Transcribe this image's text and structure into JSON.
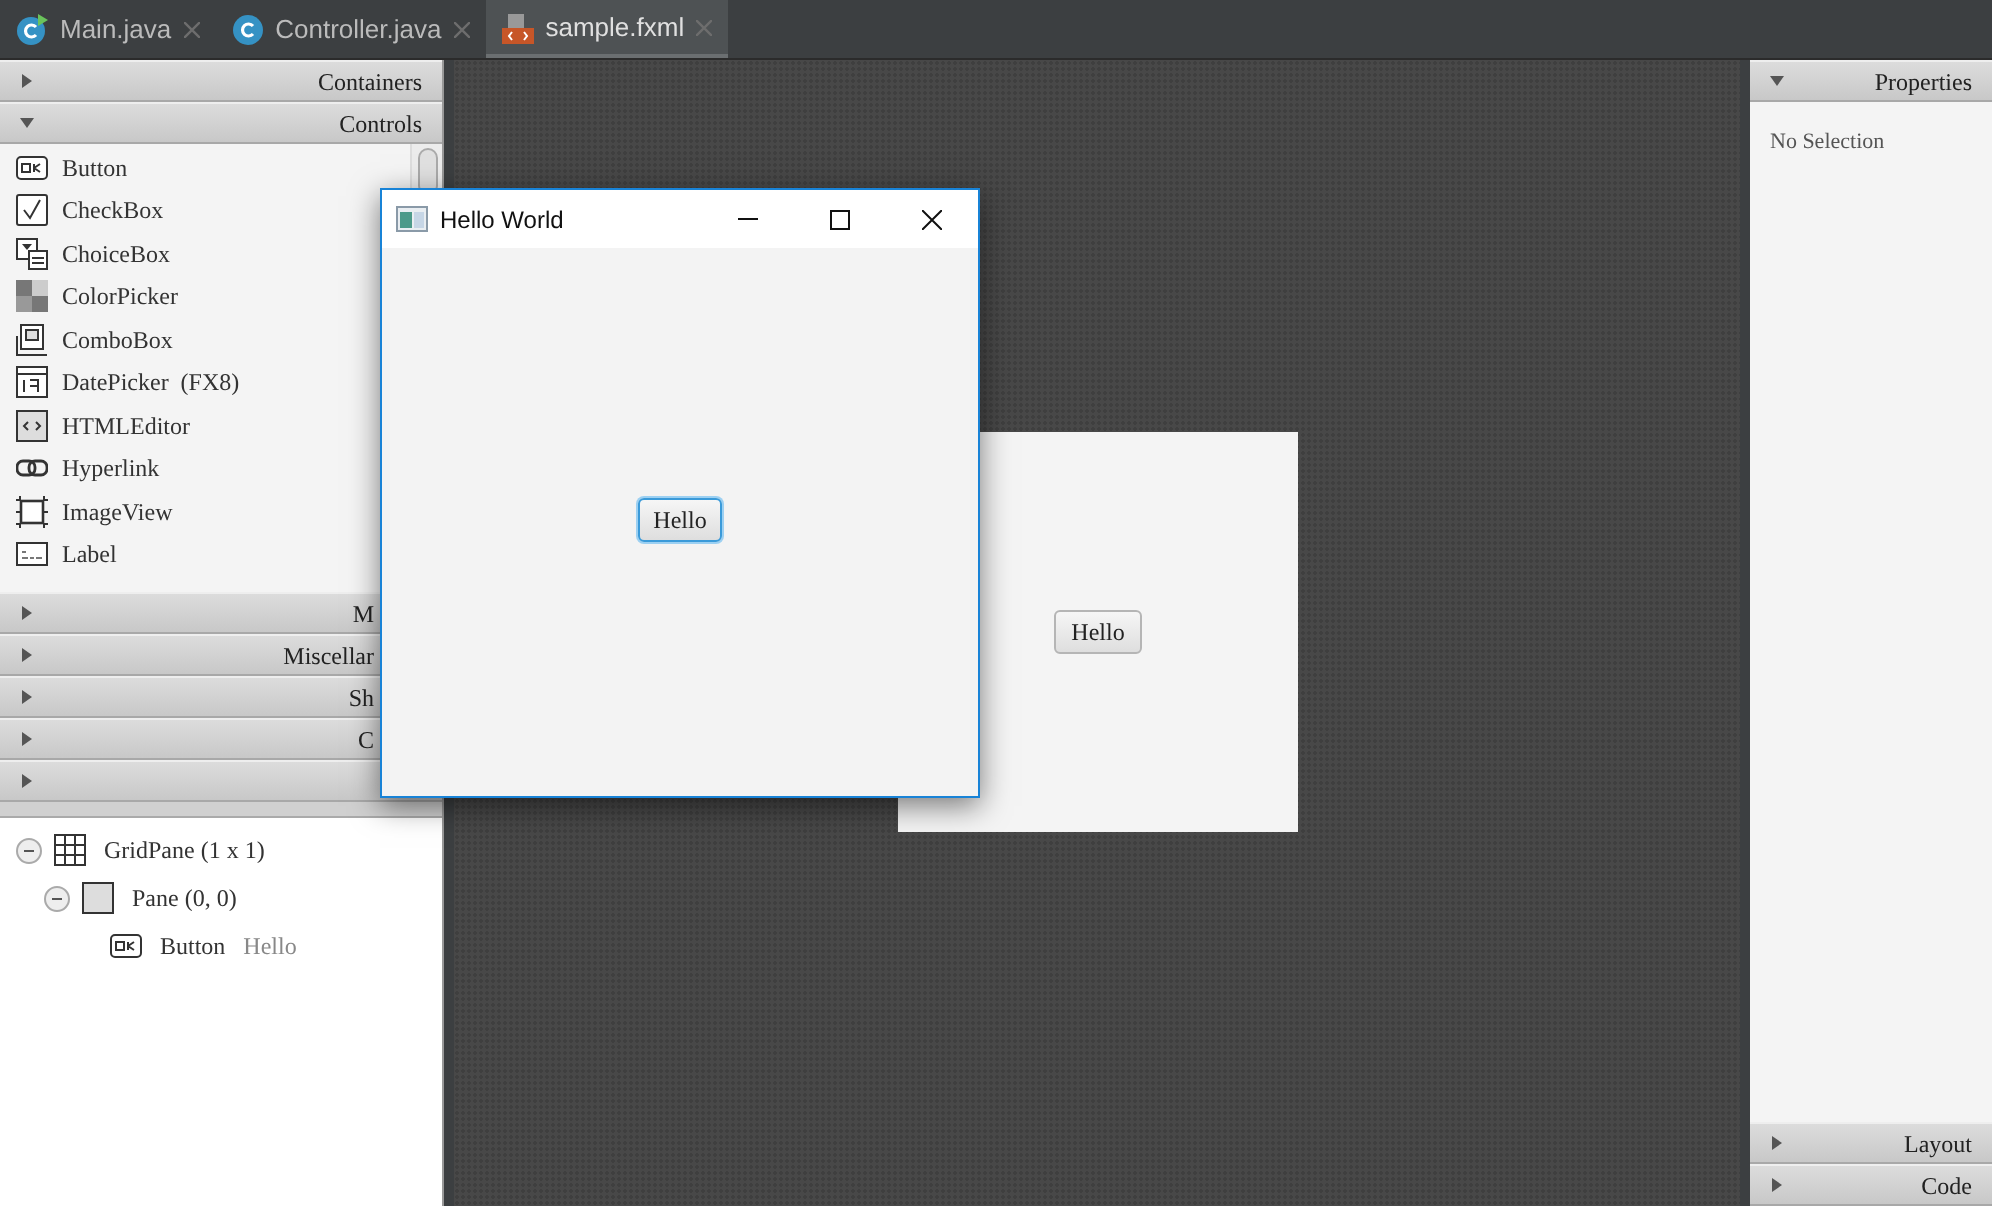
{
  "tabs": [
    {
      "label": "Main.java",
      "kind": "main_class",
      "selected": false
    },
    {
      "label": "Controller.java",
      "kind": "class",
      "selected": false
    },
    {
      "label": "sample.fxml",
      "kind": "fxml",
      "selected": true
    }
  ],
  "library": {
    "sections": [
      {
        "label": "Containers",
        "expanded": false
      },
      {
        "label": "Controls",
        "expanded": true,
        "items": [
          {
            "label": "Button",
            "kind": "button"
          },
          {
            "label": "CheckBox",
            "kind": "checkbox"
          },
          {
            "label": "ChoiceBox",
            "kind": "choicebox"
          },
          {
            "label": "ColorPicker",
            "kind": "colorpicker"
          },
          {
            "label": "ComboBox",
            "kind": "combobox"
          },
          {
            "label": "DatePicker  (FX8)",
            "kind": "datepicker"
          },
          {
            "label": "HTMLEditor",
            "kind": "htmleditor"
          },
          {
            "label": "Hyperlink",
            "kind": "hyperlink"
          },
          {
            "label": "ImageView",
            "kind": "imageview"
          },
          {
            "label": "Label",
            "kind": "label"
          }
        ]
      },
      {
        "label": "M",
        "expanded": false
      },
      {
        "label": "Miscellar",
        "expanded": false
      },
      {
        "label": "Sh",
        "expanded": false
      },
      {
        "label": "C",
        "expanded": false
      },
      {
        "expanded": false
      }
    ]
  },
  "hierarchy": [
    {
      "label": "GridPane (1 x 1)",
      "kind": "grid",
      "expanded": true,
      "children": [
        {
          "label": "Pane (0, 0)",
          "kind": "pane",
          "expanded": true,
          "children": [
            {
              "label": "Button",
              "detail": "Hello",
              "kind": "button"
            }
          ]
        }
      ]
    }
  ],
  "canvas": {
    "pane_button": "Hello"
  },
  "preview_window": {
    "title": "Hello World",
    "button": {
      "label": "Hello",
      "focused": true
    }
  },
  "inspector": {
    "sections": [
      {
        "label": "Properties",
        "expanded": true,
        "message": "No Selection"
      },
      {
        "label": "Layout",
        "expanded": false
      },
      {
        "label": "Code",
        "expanded": false
      }
    ]
  }
}
